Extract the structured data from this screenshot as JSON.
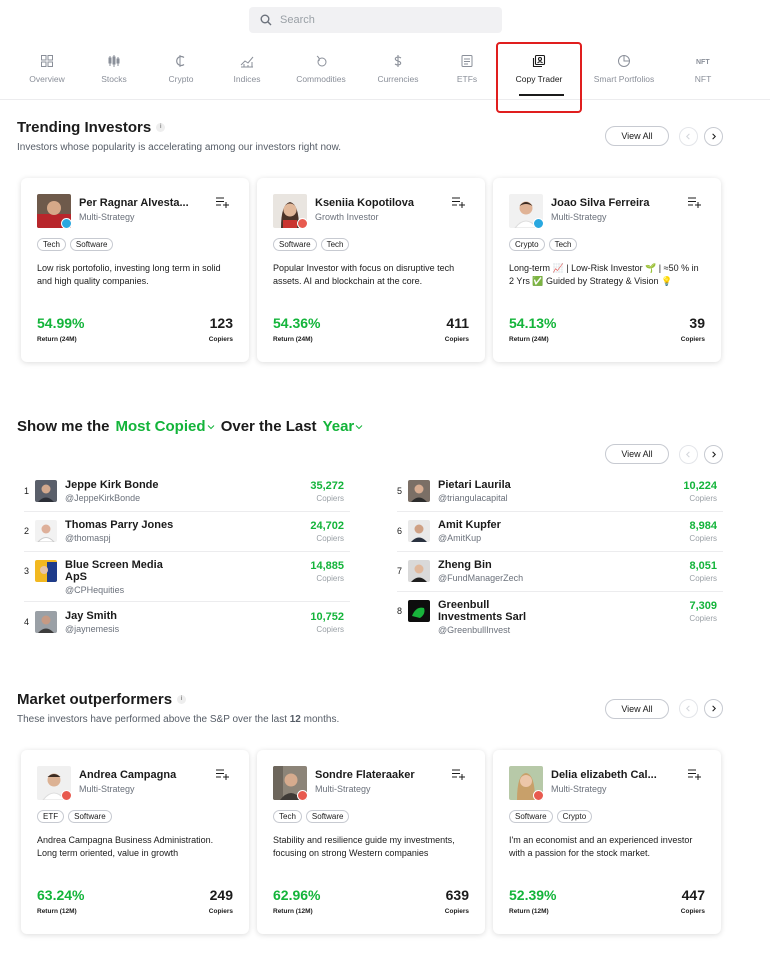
{
  "search": {
    "placeholder": "Search"
  },
  "nav": [
    {
      "label": "Overview",
      "icon": "grid-icon"
    },
    {
      "label": "Stocks",
      "icon": "candles-icon"
    },
    {
      "label": "Crypto",
      "icon": "crypto-icon"
    },
    {
      "label": "Indices",
      "icon": "indices-icon"
    },
    {
      "label": "Commodities",
      "icon": "commodities-icon"
    },
    {
      "label": "Currencies",
      "icon": "dollar-icon"
    },
    {
      "label": "ETFs",
      "icon": "etf-icon"
    },
    {
      "label": "Copy Trader",
      "icon": "copy-trader-icon"
    },
    {
      "label": "Smart Portfolios",
      "icon": "pie-icon"
    },
    {
      "label": "NFT",
      "icon": "nft-icon"
    }
  ],
  "trending": {
    "title": "Trending Investors",
    "subtitle": "Investors whose popularity is accelerating among our investors right now.",
    "view_all": "View All",
    "cards": [
      {
        "name": "Per Ragnar Alvesta...",
        "strategy": "Multi-Strategy",
        "tags": [
          "Tech",
          "Software"
        ],
        "desc": "Low risk portofolio, investing long term in solid and high quality companies.",
        "return": "54.99%",
        "return_label": "Return (24M)",
        "copiers": "123",
        "copiers_label": "Copiers"
      },
      {
        "name": "Kseniia Kopotilova",
        "strategy": "Growth Investor",
        "tags": [
          "Software",
          "Tech"
        ],
        "desc": "Popular Investor with focus on disruptive tech assets. AI and blockchain at the core.",
        "return": "54.36%",
        "return_label": "Return (24M)",
        "copiers": "411",
        "copiers_label": "Copiers"
      },
      {
        "name": "Joao Silva Ferreira",
        "strategy": "Multi-Strategy",
        "tags": [
          "Crypto",
          "Tech"
        ],
        "desc": "Long-term 📈 | Low-Risk Investor 🌱 | ≈50 % in 2 Yrs ✅ Guided by Strategy & Vision 💡",
        "return": "54.13%",
        "return_label": "Return (24M)",
        "copiers": "39",
        "copiers_label": "Copiers"
      }
    ]
  },
  "most_copied": {
    "prefix": "Show me the",
    "metric": "Most Copied",
    "middle": "Over the Last",
    "period": "Year",
    "view_all": "View All",
    "left": [
      {
        "rank": "1",
        "name": "Jeppe Kirk Bonde",
        "user": "@JeppeKirkBonde",
        "copiers": "35,272",
        "label": "Copiers"
      },
      {
        "rank": "2",
        "name": "Thomas Parry Jones",
        "user": "@thomaspj",
        "copiers": "24,702",
        "label": "Copiers"
      },
      {
        "rank": "3",
        "name": "Blue Screen Media ApS",
        "user": "@CPHequities",
        "copiers": "14,885",
        "label": "Copiers"
      },
      {
        "rank": "4",
        "name": "Jay Smith",
        "user": "@jaynemesis",
        "copiers": "10,752",
        "label": "Copiers"
      }
    ],
    "right": [
      {
        "rank": "5",
        "name": "Pietari Laurila",
        "user": "@triangulacapital",
        "copiers": "10,224",
        "label": "Copiers"
      },
      {
        "rank": "6",
        "name": "Amit Kupfer",
        "user": "@AmitKup",
        "copiers": "8,984",
        "label": "Copiers"
      },
      {
        "rank": "7",
        "name": "Zheng Bin",
        "user": "@FundManagerZech",
        "copiers": "8,051",
        "label": "Copiers"
      },
      {
        "rank": "8",
        "name": "Greenbull Investments Sarl",
        "user": "@GreenbullInvest",
        "copiers": "7,309",
        "label": "Copiers"
      }
    ]
  },
  "outperformers": {
    "title": "Market outperformers",
    "subtitle_pre": "These investors have performed above the S&P over the last",
    "subtitle_num": "12",
    "subtitle_post": "months.",
    "view_all": "View All",
    "cards": [
      {
        "name": "Andrea Campagna",
        "strategy": "Multi-Strategy",
        "tags": [
          "ETF",
          "Software"
        ],
        "desc": "Andrea Campagna Business Administration. Long term oriented, value in growth",
        "return": "63.24%",
        "return_label": "Return (12M)",
        "copiers": "249",
        "copiers_label": "Copiers"
      },
      {
        "name": "Sondre Flateraaker",
        "strategy": "Multi-Strategy",
        "tags": [
          "Tech",
          "Software"
        ],
        "desc": "Stability and resilience guide my investments, focusing on strong Western companies",
        "return": "62.96%",
        "return_label": "Return (12M)",
        "copiers": "639",
        "copiers_label": "Copiers"
      },
      {
        "name": "Delia elizabeth Cal...",
        "strategy": "Multi-Strategy",
        "tags": [
          "Software",
          "Crypto"
        ],
        "desc": "I'm an economist and an experienced investor with a passion for the stock market.",
        "return": "52.39%",
        "return_label": "Return (12M)",
        "copiers": "447",
        "copiers_label": "Copiers"
      }
    ]
  },
  "colors": {
    "accent_green": "#13b43a",
    "highlight_red": "#e01e1e",
    "badge_blue": "#29a8e0",
    "badge_red": "#e85a4f"
  }
}
